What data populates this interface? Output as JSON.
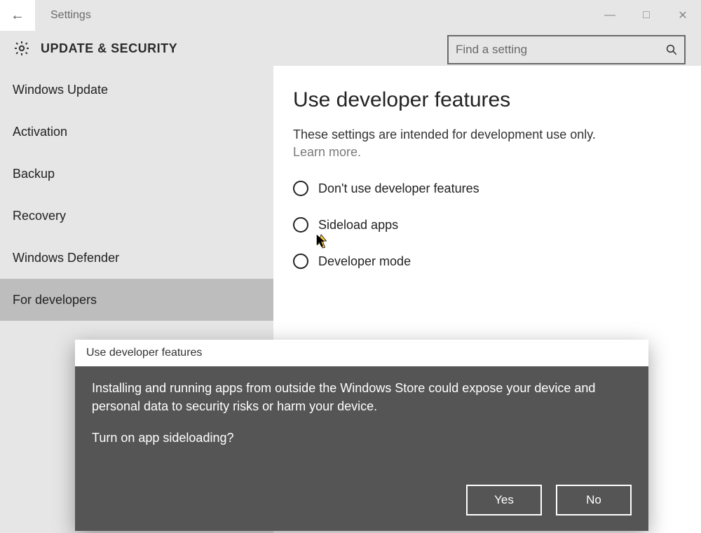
{
  "titlebar": {
    "app_name": "Settings",
    "back_glyph": "←",
    "minimize_glyph": "—",
    "maximize_glyph": "□",
    "close_glyph": "✕"
  },
  "category": {
    "title": "UPDATE & SECURITY"
  },
  "search": {
    "placeholder": "Find a setting",
    "icon_glyph": "⌕"
  },
  "sidebar": {
    "items": [
      {
        "label": "Windows Update",
        "selected": false
      },
      {
        "label": "Activation",
        "selected": false
      },
      {
        "label": "Backup",
        "selected": false
      },
      {
        "label": "Recovery",
        "selected": false
      },
      {
        "label": "Windows Defender",
        "selected": false
      },
      {
        "label": "For developers",
        "selected": true
      }
    ]
  },
  "content": {
    "heading": "Use developer features",
    "subtext": "These settings are intended for development use only.",
    "learn_more": "Learn more.",
    "options": [
      {
        "label": "Don't use developer features"
      },
      {
        "label": "Sideload apps"
      },
      {
        "label": "Developer mode"
      }
    ]
  },
  "dialog": {
    "title": "Use developer features",
    "body": "Installing and running apps from outside the Windows Store could expose your device and personal data to security risks or harm your device.",
    "question": "Turn on app sideloading?",
    "yes": "Yes",
    "no": "No"
  }
}
